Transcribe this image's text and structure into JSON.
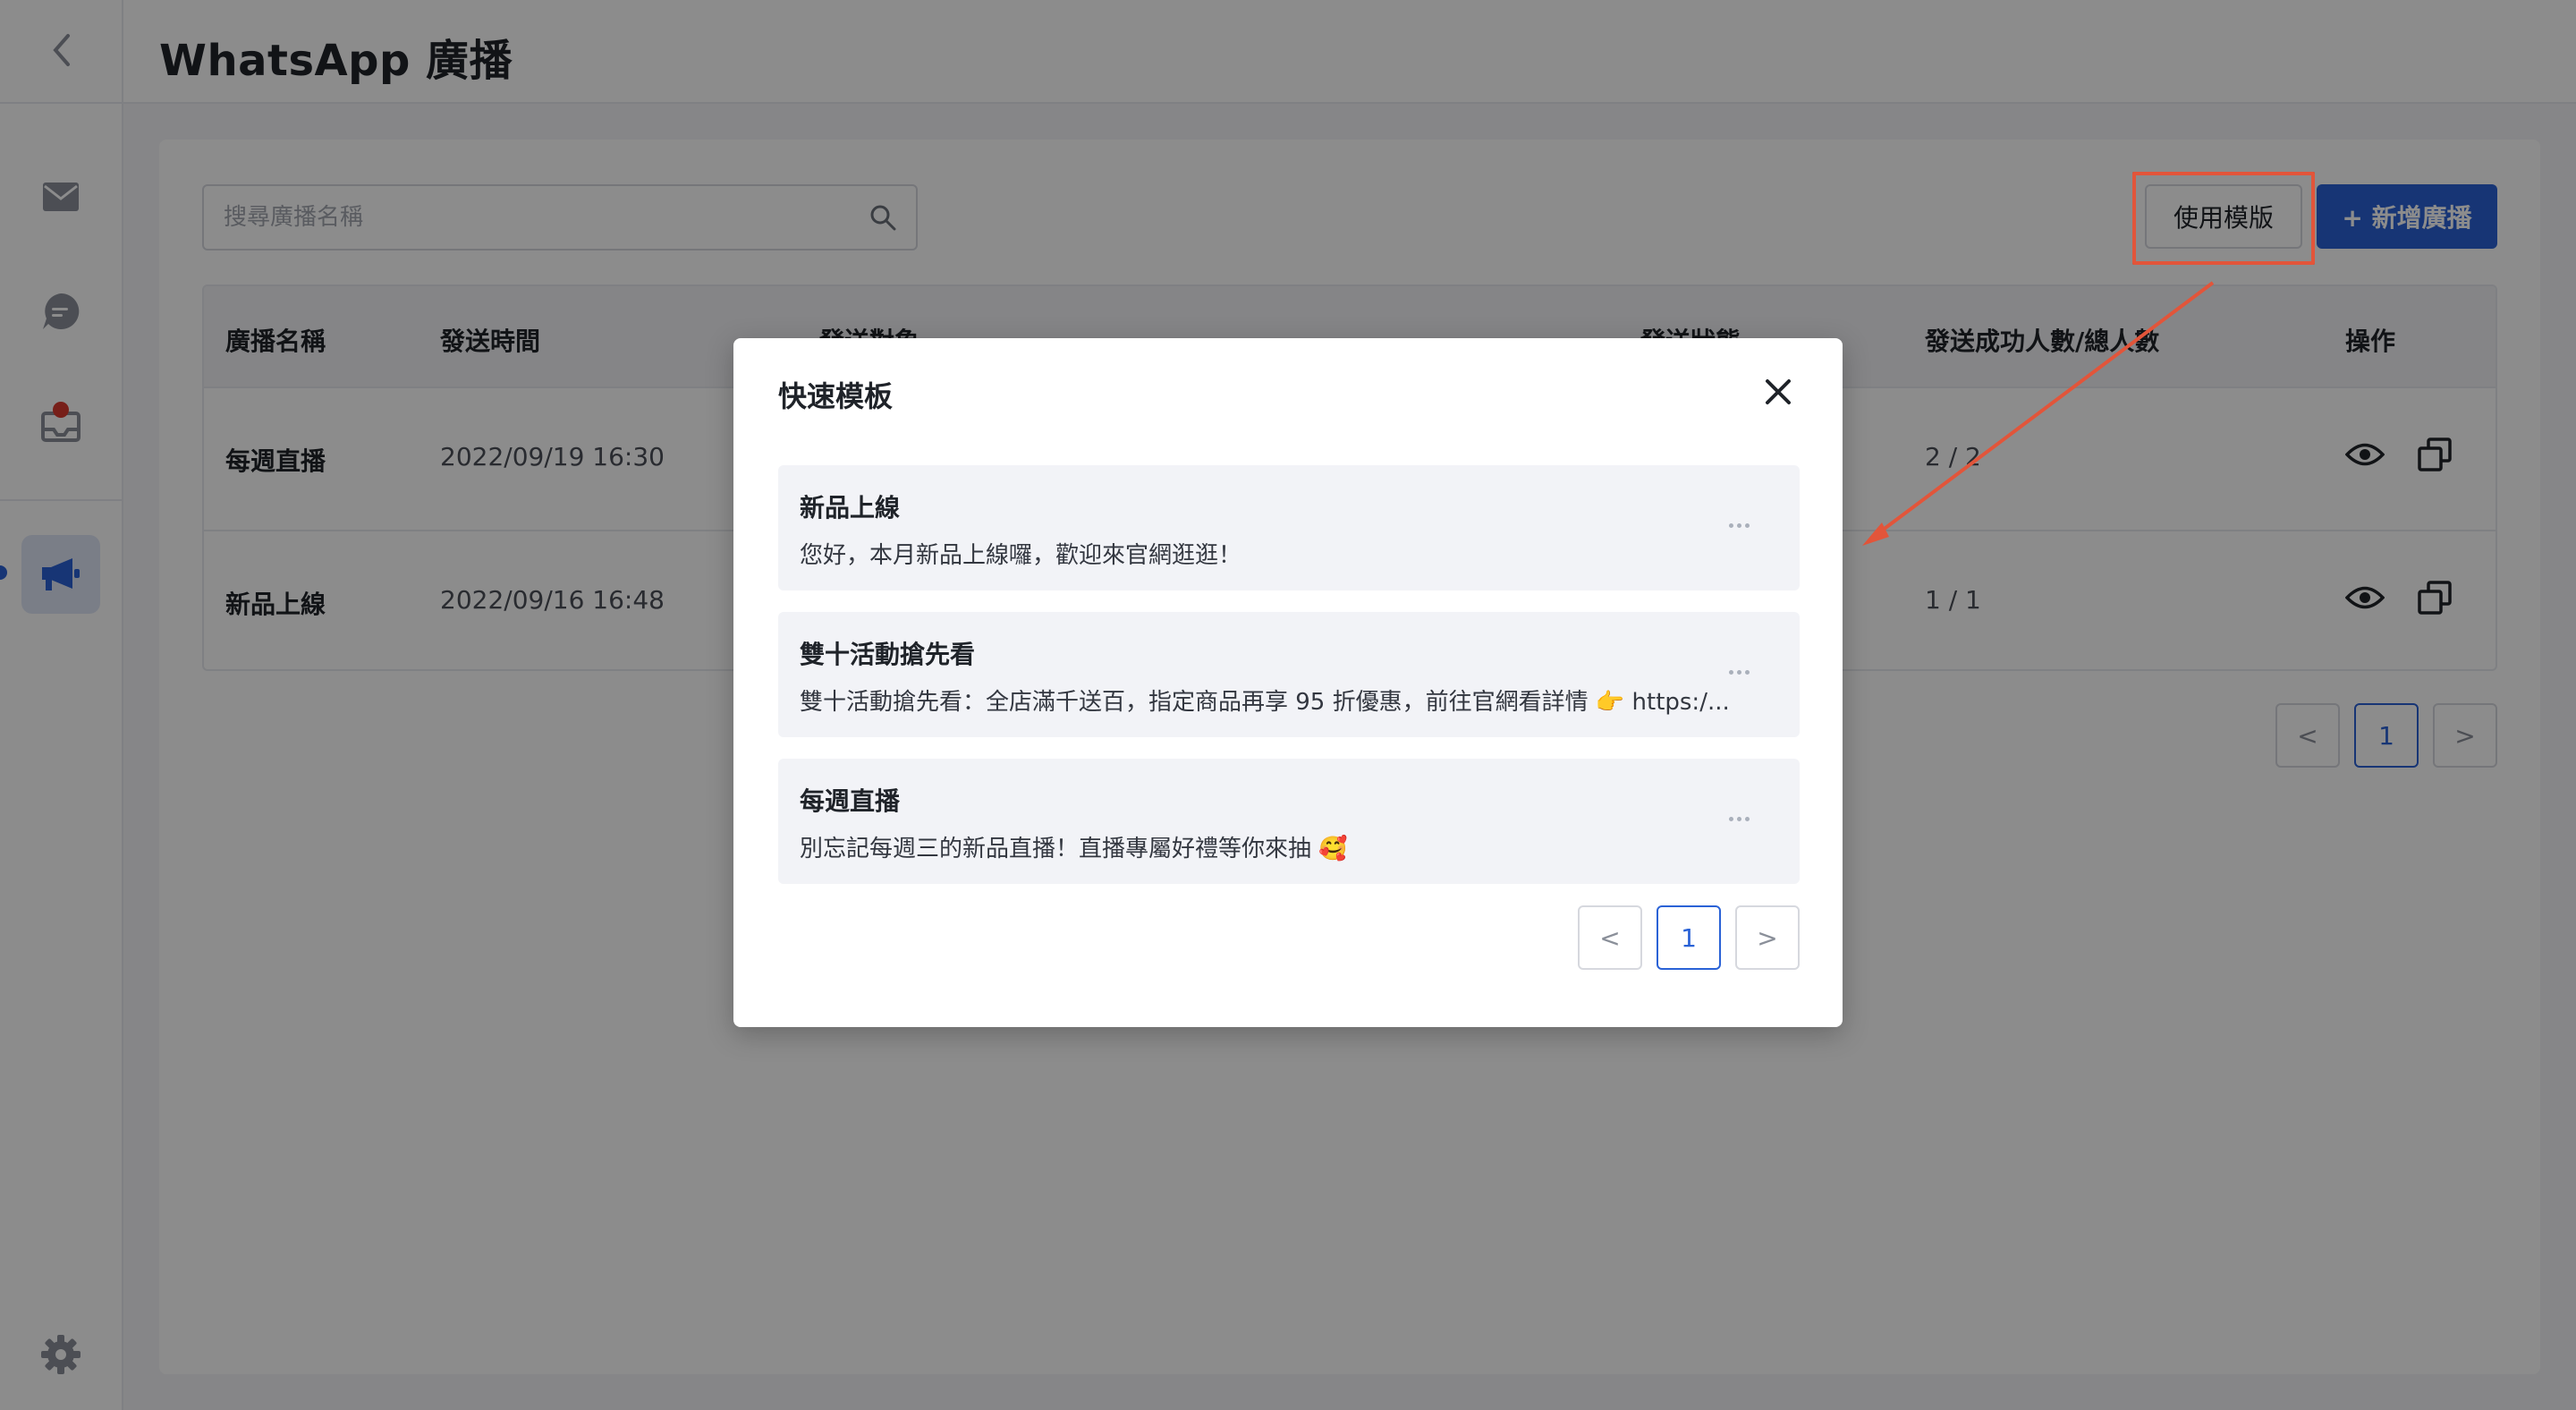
{
  "header": {
    "title": "WhatsApp 廣播"
  },
  "sidebar": {
    "items": [
      {
        "icon": "mail-icon"
      },
      {
        "icon": "chat-icon"
      },
      {
        "icon": "inbox-icon"
      },
      {
        "icon": "megaphone-icon",
        "active": true
      }
    ],
    "settings_icon": "gear-icon"
  },
  "toolbar": {
    "search_placeholder": "搜尋廣播名稱",
    "use_template_label": "使用模版",
    "new_broadcast_label": "+ 新增廣播"
  },
  "table": {
    "columns": [
      "廣播名稱",
      "發送時間",
      "發送對象",
      "發送狀態",
      "發送成功人數/總人數",
      "操作"
    ],
    "rows": [
      {
        "name": "每週直播",
        "time": "2022/09/19 16:30",
        "success_ratio": "2 / 2"
      },
      {
        "name": "新品上線",
        "time": "2022/09/16 16:48",
        "success_ratio": "1 / 1"
      }
    ]
  },
  "pagination": {
    "prev": "<",
    "current": "1",
    "next": ">"
  },
  "modal": {
    "title": "快速模板",
    "templates": [
      {
        "name": "新品上線",
        "body": "您好，本月新品上線囉，歡迎來官網逛逛！"
      },
      {
        "name": "雙十活動搶先看",
        "body": "雙十活動搶先看：全店滿千送百，指定商品再享 95 折優惠，前往官網看詳情 👉 https:/..."
      },
      {
        "name": "每週直播",
        "body": "別忘記每週三的新品直播！直播專屬好禮等你來抽 🥰"
      }
    ],
    "pagination": {
      "prev": "<",
      "current": "1",
      "next": ">"
    }
  },
  "colors": {
    "primary": "#2a62d6",
    "annotation": "#e2553a"
  }
}
